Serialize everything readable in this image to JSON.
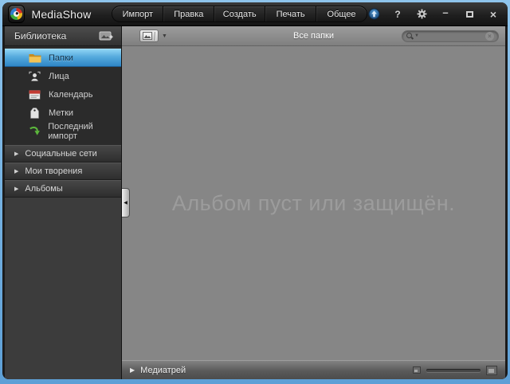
{
  "app": {
    "title": "MediaShow"
  },
  "titlebar": {
    "menu_items": [
      {
        "label": "Импорт"
      },
      {
        "label": "Правка"
      },
      {
        "label": "Создать"
      },
      {
        "label": "Печать"
      },
      {
        "label": "Общее"
      }
    ]
  },
  "glyphs": {
    "help": "?",
    "minimize": "–",
    "close": "×",
    "section_arrow": "▶",
    "tray_arrow": "▶",
    "collapse_arrow": "◀",
    "dropdown_caret": "▼",
    "search_caret": "▼",
    "clear": "×"
  },
  "sidebar": {
    "header_title": "Библиотека",
    "items": [
      {
        "label": "Папки",
        "icon": "folder-icon",
        "selected": true
      },
      {
        "label": "Лица",
        "icon": "faces-icon",
        "selected": false
      },
      {
        "label": "Календарь",
        "icon": "calendar-icon",
        "selected": false
      },
      {
        "label": "Метки",
        "icon": "tags-icon",
        "selected": false
      },
      {
        "label": "Последний импорт",
        "icon": "recent-import-icon",
        "selected": false
      }
    ],
    "sections": [
      {
        "label": "Социальные сети"
      },
      {
        "label": "Мои творения"
      },
      {
        "label": "Альбомы"
      }
    ]
  },
  "toolbar": {
    "view_title": "Все папки",
    "search_value": "",
    "search_placeholder": ""
  },
  "content": {
    "empty_message": "Альбом пуст или защищён."
  },
  "tray": {
    "label": "Медиатрей"
  },
  "colors": {
    "frame_blue": "#74afdf",
    "selected_top": "#8ed4f4",
    "selected_bottom": "#2f86c6",
    "content_gray": "#868686"
  }
}
